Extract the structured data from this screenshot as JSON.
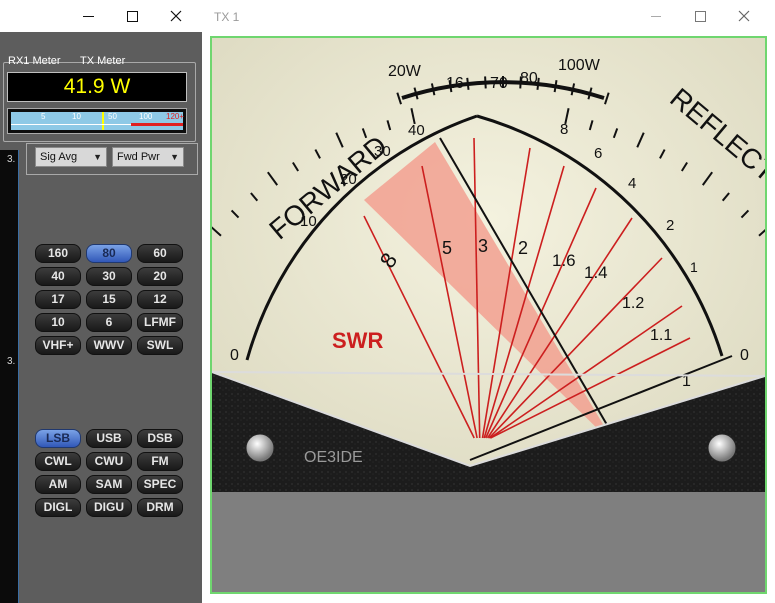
{
  "left_window": {
    "caption_buttons": {
      "minimize": "—",
      "maximize": "☐",
      "close": "✕"
    },
    "strip_numbers": [
      "3.",
      "3."
    ],
    "meter": {
      "rx_label": "RX1 Meter",
      "tx_label": "TX Meter",
      "reading": "41.9 W",
      "scale_ticks": [
        "5",
        "10",
        "50",
        "100",
        "120+"
      ],
      "fill_fraction": 0.53
    },
    "dropdowns": {
      "left": "Sig Avg",
      "right": "Fwd Pwr"
    },
    "bands": [
      "160",
      "80",
      "60",
      "40",
      "30",
      "20",
      "17",
      "15",
      "12",
      "10",
      "6",
      "LFMF",
      "VHF+",
      "WWV",
      "SWL"
    ],
    "active_band": "80",
    "modes": [
      "LSB",
      "USB",
      "DSB",
      "CWL",
      "CWU",
      "FM",
      "AM",
      "SAM",
      "SPEC",
      "DIGL",
      "DIGU",
      "DRM"
    ],
    "active_mode": "LSB"
  },
  "right_window": {
    "title": "TX 1",
    "caption_buttons": {
      "minimize": "—",
      "maximize": "☐",
      "close": "✕"
    },
    "meter": {
      "forward_label": "FORWARD",
      "reflected_label": "REFLECTED",
      "swr_label": "SWR",
      "brand": "OE3IDE",
      "forward_scale": [
        "0",
        "10",
        "20",
        "30",
        "40"
      ],
      "forward_top_scale": [
        "20W",
        "16",
        "70",
        "80",
        "100W"
      ],
      "reflected_scale": [
        "8",
        "6",
        "4",
        "2",
        "1",
        "0"
      ],
      "swr_scale": [
        "8",
        "5",
        "3",
        "2",
        "1.6",
        "1.4",
        "1.2",
        "1.1",
        "1"
      ],
      "colors": {
        "swr_red": "#cc1f1f",
        "needle": "#111111",
        "zone": "#f2a090"
      }
    }
  }
}
